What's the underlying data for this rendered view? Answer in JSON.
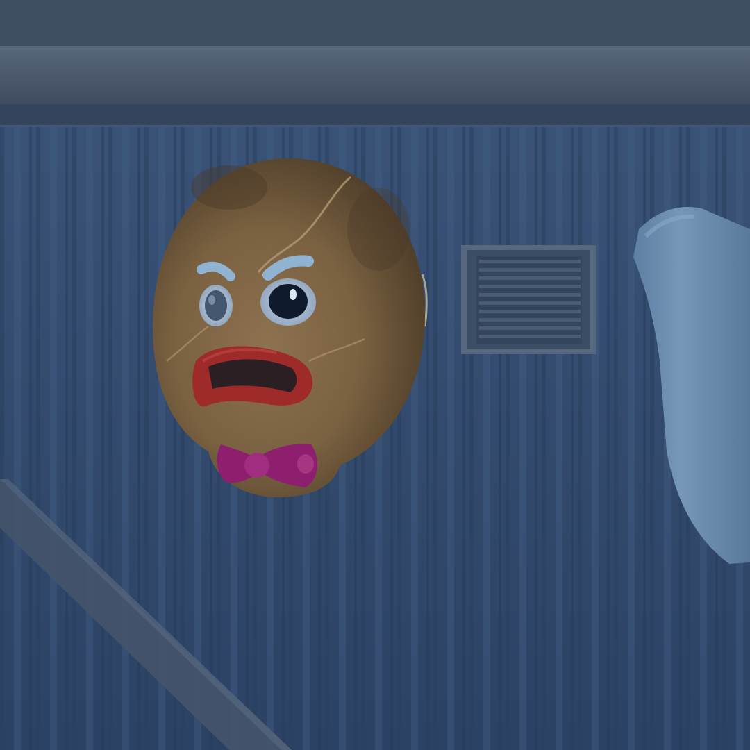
{
  "scene": {
    "type": "3d-game-view",
    "subject": "gingerbread-cookie-head-mask",
    "colors": {
      "wall_blue": "#3a5478",
      "wall_blue_dark": "#2b4062",
      "beam_gray": "#4d5d72",
      "cookie_brown": "#7d6444",
      "cookie_dark": "#5a4630",
      "icing_blue": "#8fb3d0",
      "lips_red": "#9e2a2a",
      "bowtie_magenta": "#8e1f6e",
      "vent_gray": "#5b6c84",
      "pipe_blue": "#6f90b0"
    }
  }
}
